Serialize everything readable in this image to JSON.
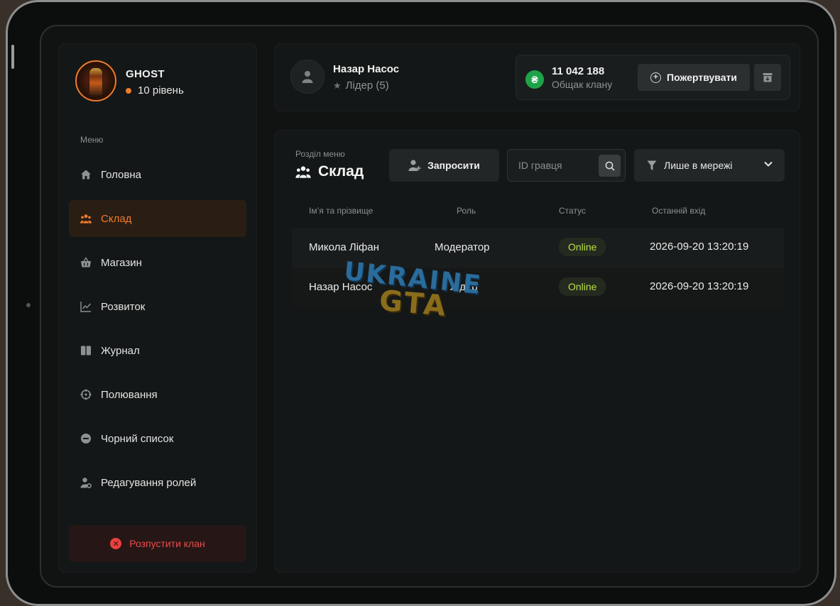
{
  "clan": {
    "name": "GHOST",
    "level": "10 рівень"
  },
  "sidebar": {
    "caption": "Меню",
    "items": [
      {
        "label": "Головна",
        "icon": "home-icon",
        "active": false
      },
      {
        "label": "Склад",
        "icon": "members-icon",
        "active": true
      },
      {
        "label": "Магазин",
        "icon": "basket-icon",
        "active": false
      },
      {
        "label": "Розвиток",
        "icon": "chart-icon",
        "active": false
      },
      {
        "label": "Журнал",
        "icon": "book-icon",
        "active": false
      },
      {
        "label": "Полювання",
        "icon": "crosshair-icon",
        "active": false
      },
      {
        "label": "Чорний список",
        "icon": "block-icon",
        "active": false
      },
      {
        "label": "Редагування ролей",
        "icon": "user-gear-icon",
        "active": false
      }
    ],
    "dissolve_label": "Розпустити клан"
  },
  "header": {
    "user_name": "Назар Насос",
    "user_role": "Лідер (5)",
    "currency_symbol": "₴",
    "balance": "11 042 188",
    "balance_caption": "Общак клану",
    "donate_label": "Пожертвувати"
  },
  "main": {
    "section_caption": "Розділ меню",
    "section_title": "Склад",
    "invite_label": "Запросити",
    "search_placeholder": "ID гравця",
    "filter_label": "Лише в мережі",
    "columns": [
      "Ім’я та прізвище",
      "Роль",
      "Статус",
      "Останній вхід"
    ],
    "rows": [
      {
        "name": "Микола Ліфан",
        "role": "Модератор",
        "status": "Online",
        "last_login": "2026-09-20 13:20:19"
      },
      {
        "name": "Назар Насос",
        "role": "Лідер",
        "status": "Online",
        "last_login": "2026-09-20 13:20:19"
      }
    ]
  },
  "watermark": {
    "line1": "UKRAINE",
    "line2": "GTA"
  },
  "colors": {
    "accent": "#f07b2c",
    "danger": "#ec4a4a",
    "online": "#b6e04a",
    "currency": "#1fa34a"
  }
}
